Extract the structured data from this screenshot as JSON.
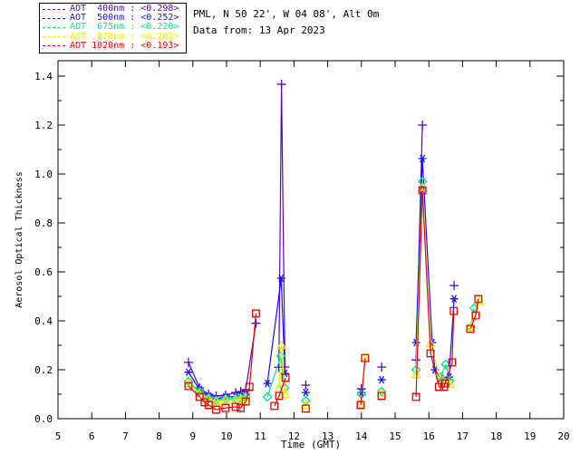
{
  "header": {
    "line1": "PML, N 50 22', W 04 08', Alt 0m",
    "line2": "Data from: 13 Apr 2023"
  },
  "legend": {
    "items": [
      {
        "label": "AOT  400nm : <0.298>",
        "color": "#5a00c8"
      },
      {
        "label": "AOT  500nm : <0.252>",
        "color": "#0f0fff"
      },
      {
        "label": "AOT  675nm : <0.220>",
        "color": "#00e096"
      },
      {
        "label": "AOT  870nm : <0.202>",
        "color": "#eeee00"
      },
      {
        "label": "AOT 1020nm : <0.193>",
        "color": "#ee0000"
      }
    ]
  },
  "chart_data": {
    "type": "scatter",
    "title": "",
    "xlabel": "Time (GMT)",
    "ylabel": "Aerosol Optical Thickness",
    "xlim": [
      5,
      20
    ],
    "ylim": [
      0,
      1.463
    ],
    "xticks": [
      5,
      6,
      7,
      8,
      9,
      10,
      11,
      12,
      13,
      14,
      15,
      16,
      17,
      18,
      19,
      20
    ],
    "yticks": [
      0.0,
      0.2,
      0.4,
      0.6,
      0.8,
      1.0,
      1.2,
      1.4
    ],
    "y_minor_step": 0.1,
    "grid": false,
    "legend_position": "top-left-outside",
    "connect_max_gap_hours": 0.45,
    "series": [
      {
        "name": "AOT 400nm",
        "wavelength_nm": 400,
        "mean_aot": 0.298,
        "color": "#5a00c8",
        "marker": "plus",
        "points": [
          [
            8.87,
            0.23
          ],
          [
            9.2,
            0.126
          ],
          [
            9.47,
            0.1
          ],
          [
            9.69,
            0.093
          ],
          [
            9.97,
            0.096
          ],
          [
            10.27,
            0.107
          ],
          [
            10.42,
            0.111
          ],
          [
            10.57,
            0.119
          ],
          [
            10.87,
            0.39
          ],
          [
            11.55,
            0.21
          ],
          [
            11.63,
            1.367
          ],
          [
            11.73,
            0.211
          ],
          [
            12.35,
            0.137
          ],
          [
            14.0,
            0.122
          ],
          [
            14.6,
            0.211
          ],
          [
            15.62,
            0.24
          ],
          [
            15.81,
            1.2
          ],
          [
            16.75,
            0.544
          ]
        ]
      },
      {
        "name": "AOT 500nm",
        "wavelength_nm": 500,
        "mean_aot": 0.252,
        "color": "#0f0fff",
        "marker": "asterisk",
        "points": [
          [
            8.87,
            0.19
          ],
          [
            9.2,
            0.119
          ],
          [
            9.47,
            0.093
          ],
          [
            9.69,
            0.081
          ],
          [
            9.97,
            0.089
          ],
          [
            10.27,
            0.09
          ],
          [
            10.42,
            0.095
          ],
          [
            10.57,
            0.1
          ],
          [
            11.21,
            0.144
          ],
          [
            11.62,
            0.574
          ],
          [
            11.73,
            0.185
          ],
          [
            12.35,
            0.107
          ],
          [
            14.0,
            0.107
          ],
          [
            14.6,
            0.159
          ],
          [
            15.62,
            0.311
          ],
          [
            15.81,
            1.063
          ],
          [
            16.1,
            0.311
          ],
          [
            16.18,
            0.2
          ],
          [
            16.35,
            0.165
          ],
          [
            16.6,
            0.17
          ],
          [
            16.75,
            0.49
          ]
        ]
      },
      {
        "name": "AOT 675nm",
        "wavelength_nm": 675,
        "mean_aot": 0.22,
        "color": "#00e096",
        "marker": "diamond",
        "points": [
          [
            8.87,
            0.152
          ],
          [
            9.2,
            0.111
          ],
          [
            9.47,
            0.085
          ],
          [
            9.69,
            0.074
          ],
          [
            9.97,
            0.081
          ],
          [
            10.27,
            0.082
          ],
          [
            10.42,
            0.085
          ],
          [
            10.57,
            0.09
          ],
          [
            11.21,
            0.089
          ],
          [
            11.61,
            0.256
          ],
          [
            11.72,
            0.126
          ],
          [
            12.35,
            0.074
          ],
          [
            14.0,
            0.1
          ],
          [
            14.6,
            0.111
          ],
          [
            15.62,
            0.2
          ],
          [
            15.81,
            0.97
          ],
          [
            16.35,
            0.17
          ],
          [
            16.5,
            0.222
          ],
          [
            16.62,
            0.155
          ],
          [
            17.25,
            0.374
          ],
          [
            17.34,
            0.452
          ]
        ]
      },
      {
        "name": "AOT 870nm",
        "wavelength_nm": 870,
        "mean_aot": 0.202,
        "color": "#eeee00",
        "marker": "triangle",
        "points": [
          [
            8.87,
            0.145
          ],
          [
            9.2,
            0.104
          ],
          [
            9.47,
            0.08
          ],
          [
            9.69,
            0.07
          ],
          [
            9.97,
            0.076
          ],
          [
            10.27,
            0.076
          ],
          [
            10.42,
            0.08
          ],
          [
            10.57,
            0.085
          ],
          [
            11.56,
            0.126
          ],
          [
            11.63,
            0.3
          ],
          [
            11.74,
            0.1
          ],
          [
            12.35,
            0.056
          ],
          [
            13.98,
            0.06
          ],
          [
            14.11,
            0.248
          ],
          [
            14.6,
            0.104
          ],
          [
            15.62,
            0.18
          ],
          [
            15.81,
            0.945
          ],
          [
            16.05,
            0.307
          ],
          [
            16.35,
            0.16
          ],
          [
            16.62,
            0.144
          ],
          [
            17.23,
            0.374
          ],
          [
            17.5,
            0.48
          ]
        ]
      },
      {
        "name": "AOT 1020nm",
        "wavelength_nm": 1020,
        "mean_aot": 0.193,
        "color": "#ee0000",
        "marker": "square",
        "points": [
          [
            8.87,
            0.133
          ],
          [
            9.2,
            0.089
          ],
          [
            9.35,
            0.067
          ],
          [
            9.47,
            0.056
          ],
          [
            9.69,
            0.037
          ],
          [
            9.97,
            0.044
          ],
          [
            10.27,
            0.048
          ],
          [
            10.42,
            0.044
          ],
          [
            10.57,
            0.07
          ],
          [
            10.68,
            0.13
          ],
          [
            10.87,
            0.43
          ],
          [
            11.42,
            0.052
          ],
          [
            11.56,
            0.093
          ],
          [
            11.75,
            0.167
          ],
          [
            12.35,
            0.041
          ],
          [
            13.98,
            0.056
          ],
          [
            14.11,
            0.248
          ],
          [
            14.6,
            0.093
          ],
          [
            15.62,
            0.089
          ],
          [
            15.81,
            0.933
          ],
          [
            16.05,
            0.267
          ],
          [
            16.3,
            0.13
          ],
          [
            16.45,
            0.13
          ],
          [
            16.48,
            0.144
          ],
          [
            16.69,
            0.23
          ],
          [
            16.74,
            0.44
          ],
          [
            17.23,
            0.367
          ],
          [
            17.39,
            0.422
          ],
          [
            17.47,
            0.489
          ]
        ]
      }
    ]
  }
}
